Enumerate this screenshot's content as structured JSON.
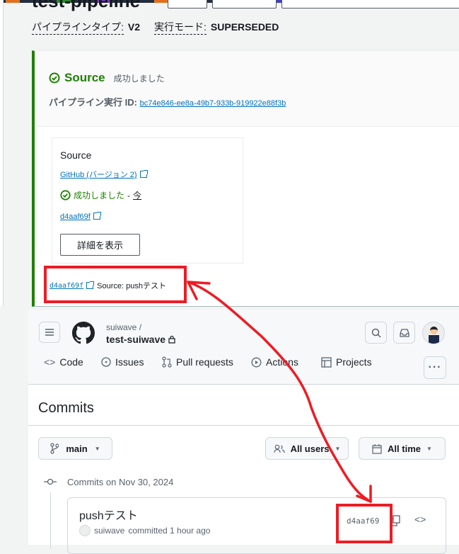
{
  "pipeline": {
    "title": "test-pipeline",
    "type_label": "パイプラインタイプ:",
    "type_value": "V2",
    "mode_label": "実行モード:",
    "mode_value": "SUPERSEDED"
  },
  "stage": {
    "name": "Source",
    "status": "成功しました",
    "execution_id_label": "パイプライン実行 ID:",
    "execution_id": "bc74e846-ee8a-49b7-933b-919922e88f3b",
    "action": {
      "name": "Source",
      "provider": "GitHub (バージョン 2)",
      "status": "成功しました",
      "time_sep": "-",
      "time": "今",
      "commit": "d4aaf69f",
      "details_button": "詳細を表示"
    },
    "commit_summary": {
      "commit": "d4aaf69f",
      "message": "Source: pushテスト"
    }
  },
  "github": {
    "owner": "suiwave /",
    "repo": "test-suiwave",
    "nav": [
      "Code",
      "Issues",
      "Pull requests",
      "Actions",
      "Projects"
    ],
    "page_title": "Commits",
    "branch": "main",
    "users_filter": "All users",
    "time_filter": "All time",
    "date_header": "Commits on Nov 30, 2024",
    "commits": [
      {
        "message": "pushテスト",
        "author": "suiwave",
        "meta": "committed 1 hour ago",
        "sha": "d4aaf69"
      }
    ]
  },
  "colors": {
    "success": "#1d8102",
    "link": "#0073bb",
    "annotation": "#ed1c24"
  }
}
